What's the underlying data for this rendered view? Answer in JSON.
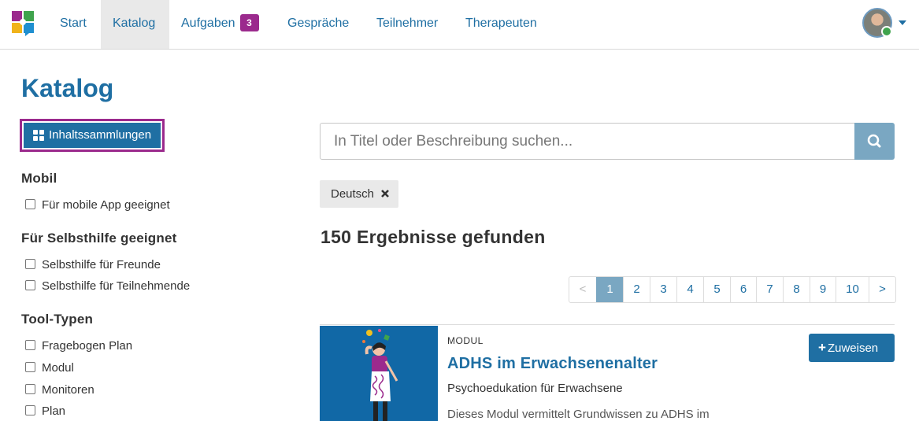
{
  "nav": {
    "items": [
      {
        "label": "Start"
      },
      {
        "label": "Katalog",
        "active": true
      },
      {
        "label": "Aufgaben",
        "badge": "3"
      },
      {
        "label": "Gespräche"
      },
      {
        "label": "Teilnehmer"
      },
      {
        "label": "Therapeuten"
      }
    ]
  },
  "page": {
    "title": "Katalog",
    "collections_button": "Inhaltssammlungen"
  },
  "filters": {
    "mobile": {
      "heading": "Mobil",
      "options": [
        "Für mobile App geeignet"
      ]
    },
    "selfhelp": {
      "heading": "Für Selbsthilfe geeignet",
      "options": [
        "Selbsthilfe für Freunde",
        "Selbsthilfe für Teilnehmende"
      ]
    },
    "tooltypes": {
      "heading": "Tool-Typen",
      "options": [
        "Fragebogen Plan",
        "Modul",
        "Monitoren",
        "Plan"
      ]
    }
  },
  "search": {
    "placeholder": "In Titel oder Beschreibung suchen...",
    "icon": "search-icon"
  },
  "active_filter": {
    "label": "Deutsch",
    "icon": "close-icon"
  },
  "results": {
    "title": "150 Ergebnisse gefunden"
  },
  "pagination": {
    "prev": "<",
    "pages": [
      "1",
      "2",
      "3",
      "4",
      "5",
      "6",
      "7",
      "8",
      "9",
      "10"
    ],
    "current": "1",
    "next": ">"
  },
  "card": {
    "type": "MODUL",
    "title": "ADHS im Erwachsenenalter",
    "subtitle": "Psychoedukation für Erwachsene",
    "description": "Dieses Modul vermittelt Grundwissen zu ADHS im",
    "assign_button": "Zuweisen"
  },
  "colors": {
    "primary": "#1f6fa3",
    "accent": "#9b2a8d",
    "muted_button": "#7aa7c2"
  }
}
